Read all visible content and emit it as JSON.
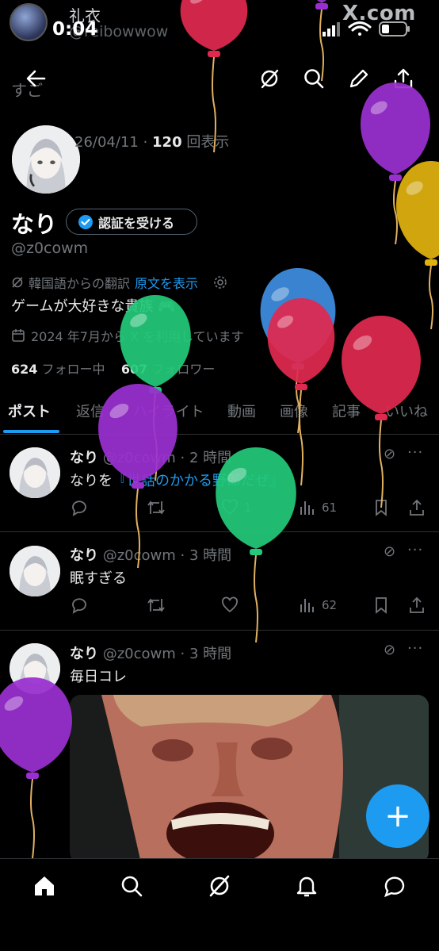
{
  "watermark": {
    "user_name": "礼衣",
    "user_handle": "@reibowwow",
    "logo": "X.com"
  },
  "statusbar": {
    "time": "0:04",
    "icons": [
      "signal-icon",
      "wifi-icon",
      "battery-icon"
    ]
  },
  "topnav": {
    "back_icon": "back-arrow-icon",
    "icons": [
      "grok-icon",
      "search-icon",
      "edit-icon",
      "share-icon"
    ],
    "background_text": "すご"
  },
  "profile": {
    "view_date": "26/04/11 · ",
    "view_count": "120",
    "view_suffix": " 回表示",
    "display_name": "なり",
    "verify_button": "認証を受ける",
    "handle": "@z0cowm",
    "translation_note": "韓国語からの翻訳",
    "show_original": "原文を表示",
    "bio": "ゲームが大好きな貴族",
    "joined": "2024 年7月から X を利用しています",
    "following_count": "624",
    "following_label": " フォロー中",
    "followers_count": "607",
    "followers_label": " フォロワー"
  },
  "tabs": [
    "ポスト",
    "返信",
    "ハイライト",
    "動画",
    "画像",
    "記事",
    "いいね"
  ],
  "active_tab": "ポスト",
  "posts": [
    {
      "name": "なり",
      "handle": "@z0cowm",
      "time": "· 2 時間",
      "text_prefix": "なりを",
      "text_link": "『世話のかかる野郎だぜ』",
      "likes": "1",
      "views": "61"
    },
    {
      "name": "なり",
      "handle": "@z0cowm",
      "time": "· 3 時間",
      "text_prefix": "眠すぎる",
      "text_link": "",
      "likes": "",
      "views": "62"
    },
    {
      "name": "なり",
      "handle": "@z0cowm",
      "time": "· 3 時間",
      "text_prefix": "毎日コレ",
      "text_link": "",
      "likes": "",
      "views": ""
    }
  ],
  "fab_label": "+",
  "bottomnav": [
    "home-icon",
    "search-icon",
    "grok-icon",
    "notifications-icon",
    "messages-icon"
  ],
  "colors": {
    "accent": "#1d9bf0",
    "background": "#000000",
    "muted_text": "#71767b",
    "balloon_red": "#e0294f",
    "balloon_purple": "#9a2fd0",
    "balloon_gold": "#e0b10f",
    "balloon_blue": "#3d8de0",
    "balloon_green": "#22c97a"
  }
}
